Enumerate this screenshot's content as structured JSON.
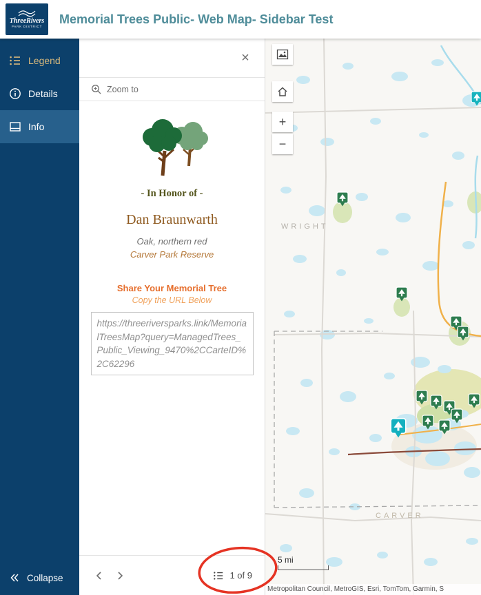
{
  "header": {
    "logo": {
      "line1": "ThreeRivers",
      "line2": "PARK DISTRICT"
    },
    "title": "Memorial Trees Public- Web Map- Sidebar Test"
  },
  "sidebar": {
    "items": [
      {
        "label": "Legend"
      },
      {
        "label": "Details"
      },
      {
        "label": "Info"
      }
    ],
    "collapse_label": "Collapse"
  },
  "panel": {
    "close_icon": "×",
    "zoom_to_label": "Zoom to",
    "honor_line": "- In Honor of -",
    "tree_name": "Dan Braunwarth",
    "tree_species": "Oak, northern red",
    "tree_location": "Carver Park Reserve",
    "share_title": "Share Your Memorial Tree",
    "share_subtitle": "Copy the URL Below",
    "share_url": "https://threeriversparks.link/MemorialTreesMap?query=ManagedTrees_Public_Viewing_9470%2CCarteID%2C62296",
    "pager_label": "1 of 9"
  },
  "map": {
    "county_labels": {
      "wright": "WRIGHT",
      "carver": "CARVER"
    },
    "scale_label": "5 mi",
    "attribution": "Metropolitan Council, MetroGIS, Esri, TomTom, Garmin, S",
    "controls": {
      "zoom_in": "+",
      "zoom_out": "−"
    }
  },
  "colors": {
    "brand_navy": "#0c406b",
    "title_teal": "#4e8c99",
    "accent_orange": "#e66f2e",
    "legend_gold": "#d9b97c",
    "name_brown": "#8f5a20",
    "marker_green": "#2e7d4f",
    "selected_marker_teal": "#14b0bf",
    "annotation_red": "#e53323"
  }
}
